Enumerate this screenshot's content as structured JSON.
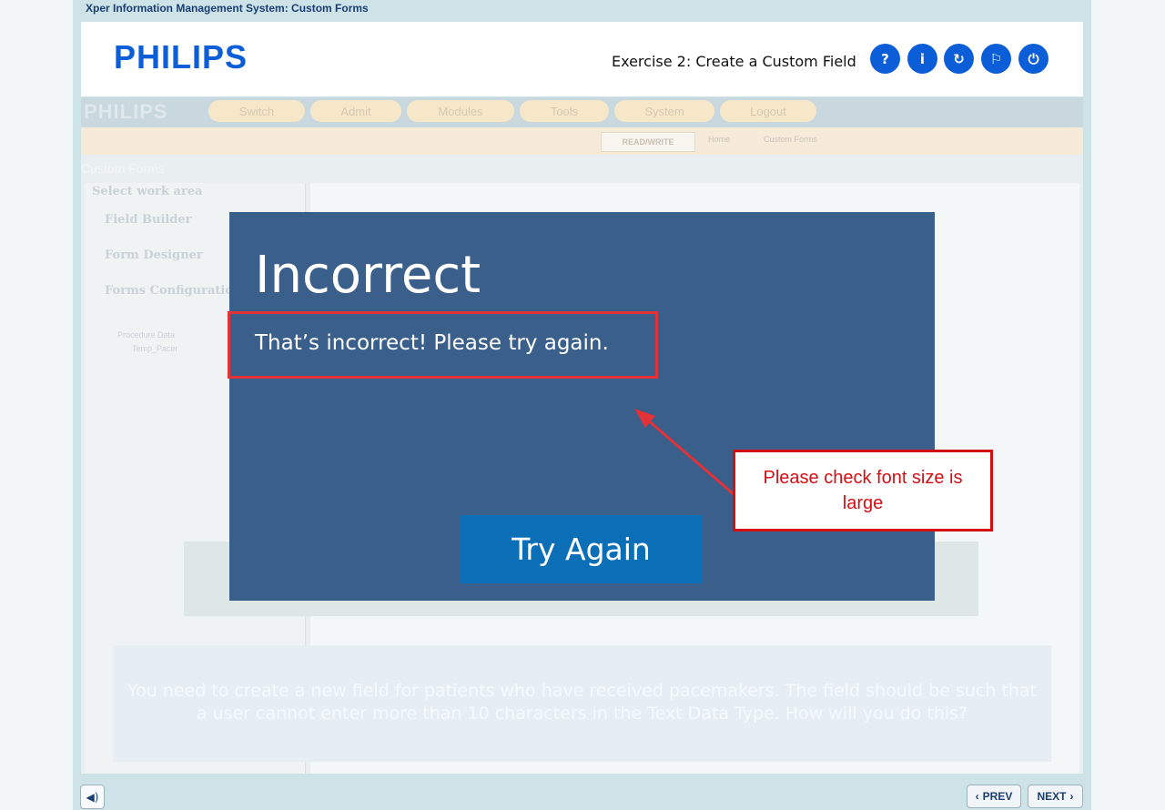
{
  "app": {
    "window_title": "Xper Information Management System: Custom Forms",
    "logo": "PHILIPS",
    "exercise_title": "Exercise 2: Create a Custom Field",
    "header_buttons": [
      {
        "name": "help",
        "glyph": "?"
      },
      {
        "name": "info",
        "glyph": "i"
      },
      {
        "name": "reset",
        "glyph": "↻"
      },
      {
        "name": "glossary",
        "glyph": "⚐"
      },
      {
        "name": "exit",
        "glyph": "⏻"
      }
    ],
    "accent_color": "#0b5ed7"
  },
  "background_app": {
    "logo": "PHILIPS",
    "menu": [
      "Switch",
      "Admit",
      "Modules",
      "Tools",
      "System",
      "Logout"
    ],
    "mode_badge": "READ/WRITE",
    "breadcrumb": [
      "Home",
      "Custom Forms"
    ],
    "section_title": "Custom Forms",
    "work_area_title": "Select work area",
    "work_areas": [
      "Field Builder",
      "Form Designer",
      "Forms Configuration"
    ],
    "tree_items": [
      "Procedure Data",
      "Temp_Pacer"
    ],
    "question": "You need to create a new field for patients who have received pacemakers. The field should be such that a user cannot enter more than 10 characters in the Text Data Type. How will you do this?"
  },
  "dialog": {
    "title": "Incorrect",
    "message": "That’s incorrect! Please try again.",
    "button_label": "Try Again",
    "background_color": "#3a5f8b"
  },
  "annotation": {
    "callout_text": "Please check font size is large",
    "color": "#d40f14"
  },
  "footer": {
    "prev_label": "PREV",
    "next_label": "NEXT"
  }
}
